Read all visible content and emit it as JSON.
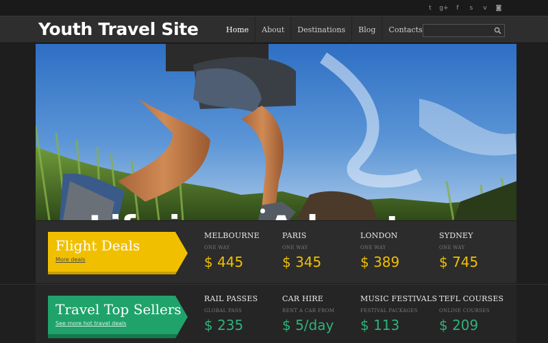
{
  "social": {
    "icons": [
      "twitter-icon",
      "google-plus-icon",
      "facebook-icon",
      "skype-icon",
      "vimeo-icon",
      "instagram-icon"
    ],
    "glyphs": [
      "t",
      "g+",
      "f",
      "s",
      "v",
      "◙"
    ]
  },
  "header": {
    "logo": "Youth Travel Site",
    "menu": [
      "Home",
      "About",
      "Destinations",
      "Blog",
      "Contacts"
    ],
    "active": "Home",
    "search_placeholder": ""
  },
  "hero": {
    "title": "Life is an Adventure"
  },
  "flight_deals": {
    "title": "Flight Deals",
    "link": "More deals",
    "color": "#f0c000",
    "items": [
      {
        "name": "MELBOURNE",
        "sub": "ONE WAY",
        "price": "$ 445"
      },
      {
        "name": "PARIS",
        "sub": "ONE WAY",
        "price": "$ 345"
      },
      {
        "name": "LONDON",
        "sub": "ONE WAY",
        "price": "$ 389"
      },
      {
        "name": "SYDNEY",
        "sub": "ONE WAY",
        "price": "$ 745"
      }
    ]
  },
  "top_sellers": {
    "title": "Travel Top Sellers",
    "link": "See more hot travel deals",
    "color": "#1fa36b",
    "items": [
      {
        "name": "RAIL PASSES",
        "sub": "GLOBAL PASS",
        "price": "$ 235"
      },
      {
        "name": "CAR HIRE",
        "sub": "RENT A CAR FROM",
        "price": "$ 5/day"
      },
      {
        "name": "MUSIC FESTIVALS",
        "sub": "FESTIVAL PACKAGES",
        "price": "$ 113"
      },
      {
        "name": "TEFL COURSES",
        "sub": "ONLINE COURSES",
        "price": "$ 209"
      }
    ]
  }
}
